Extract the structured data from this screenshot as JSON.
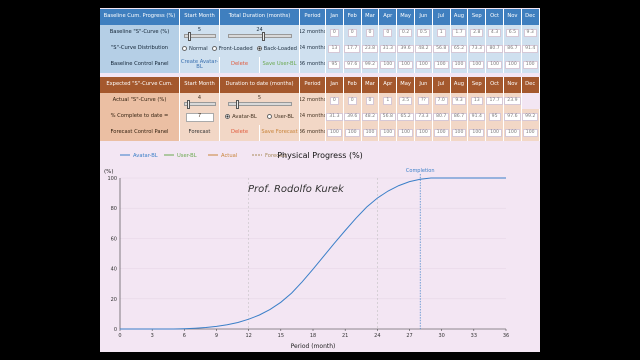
{
  "months": [
    "Jan",
    "Feb",
    "Mar",
    "Apr",
    "May",
    "Jun",
    "Jul",
    "Aug",
    "Sep",
    "Oct",
    "Nov",
    "Dec"
  ],
  "baseline": {
    "header": {
      "progress": "Baseline Cum. Progress (%)",
      "start": "Start Month",
      "duration": "Total Duration (months)",
      "period": "Period"
    },
    "curve_label": "Baseline \"S\"-Curve (%)",
    "start_value": "5",
    "duration_value": "24",
    "start_slider_fraction": 0.12,
    "duration_slider_fraction": 0.55,
    "distribution_label": "\"S\"-Curve Distribution",
    "distribution_options": [
      "Normal",
      "Front-Loaded",
      "Back-Loaded"
    ],
    "distribution_selected": 2,
    "control_label": "Baseline Control Panel",
    "create_button": "Create Avatar-BL",
    "delete_button": "Delete",
    "save_button": "Save User-BL",
    "period_rows": [
      {
        "period": "12 months",
        "values": [
          "0",
          "0",
          "0",
          "0",
          "0.2",
          "0.5",
          "1",
          "1.7",
          "2.8",
          "4.3",
          "6.5",
          "9.3"
        ]
      },
      {
        "period": "24 months",
        "values": [
          "13",
          "17.7",
          "23.8",
          "31.3",
          "39.6",
          "48.2",
          "56.8",
          "65.2",
          "73.3",
          "80.7",
          "86.7",
          "91.4"
        ]
      },
      {
        "period": "36 months",
        "values": [
          "95",
          "97.6",
          "99.2",
          "100",
          "100",
          "100",
          "100",
          "100",
          "100",
          "100",
          "100",
          "100"
        ]
      }
    ]
  },
  "expected": {
    "header": {
      "progress": "Expected \"S\"-Curve Cum.",
      "start": "Start Month",
      "duration": "Duration to date (months)",
      "period": "Period"
    },
    "actual_label": "Actual \"S\"-Curve (%)",
    "start_value": "4",
    "duration_value": "5",
    "start_slider_fraction": 0.1,
    "duration_slider_fraction": 0.12,
    "complete_label": "% Complete to date =",
    "complete_value": "7",
    "bl_options": [
      "Avatar-BL",
      "User-BL"
    ],
    "bl_selected": 0,
    "forecast_label": "Forecast Control Panel",
    "forecast_button": "Forecast",
    "delete_button": "Delete",
    "save_button": "Save Forecast",
    "period_rows": [
      {
        "period": "12 months",
        "values": [
          "0",
          "0",
          "0",
          "1",
          "3.5",
          "??",
          "7.0",
          "9.3",
          "13",
          "17.7",
          "23.9"
        ]
      },
      {
        "period": "24 months",
        "values": [
          "31.3",
          "39.6",
          "48.2",
          "56.8",
          "65.2",
          "73.3",
          "80.7",
          "86.7",
          "91.4",
          "95",
          "97.6",
          "99.2"
        ]
      },
      {
        "period": "36 months",
        "values": [
          "100",
          "100",
          "100",
          "100",
          "100",
          "100",
          "100",
          "100",
          "100",
          "100",
          "100",
          "100"
        ]
      }
    ]
  },
  "chart_data": {
    "type": "line",
    "title": "Physical Progress (%)",
    "ylabel": "(%)",
    "xlabel": "Period (month)",
    "xlim": [
      0,
      36
    ],
    "ylim": [
      0,
      100
    ],
    "xticks": [
      0,
      3,
      6,
      9,
      12,
      15,
      18,
      21,
      24,
      27,
      30,
      33,
      36
    ],
    "yticks": [
      0,
      20,
      40,
      60,
      80,
      100
    ],
    "legend": [
      "Avatar-BL",
      "User-BL",
      "Actual",
      "Forecast"
    ],
    "legend_colors": [
      "#3a7fc8",
      "#6aa84f",
      "#c8843a",
      "#a88a5a"
    ],
    "completion_label": "Completion",
    "completion_x": 28,
    "vlines": [
      12,
      24
    ],
    "watermark": "Prof. Rodolfo Kurek",
    "series": [
      {
        "name": "Avatar-BL",
        "color": "#3a7fc8",
        "x": [
          0,
          1,
          2,
          3,
          4,
          5,
          6,
          7,
          8,
          9,
          10,
          11,
          12,
          13,
          14,
          15,
          16,
          17,
          18,
          19,
          20,
          21,
          22,
          23,
          24,
          25,
          26,
          27,
          28,
          29,
          30,
          31,
          32,
          33,
          34,
          35,
          36
        ],
        "y": [
          0,
          0,
          0,
          0,
          0,
          0,
          0.2,
          0.5,
          1,
          1.7,
          2.8,
          4.3,
          6.5,
          9.3,
          13,
          17.7,
          23.8,
          31.3,
          39.6,
          48.2,
          56.8,
          65.2,
          73.3,
          80.7,
          86.7,
          91.4,
          95,
          97.6,
          99.2,
          100,
          100,
          100,
          100,
          100,
          100,
          100,
          100
        ]
      }
    ]
  }
}
